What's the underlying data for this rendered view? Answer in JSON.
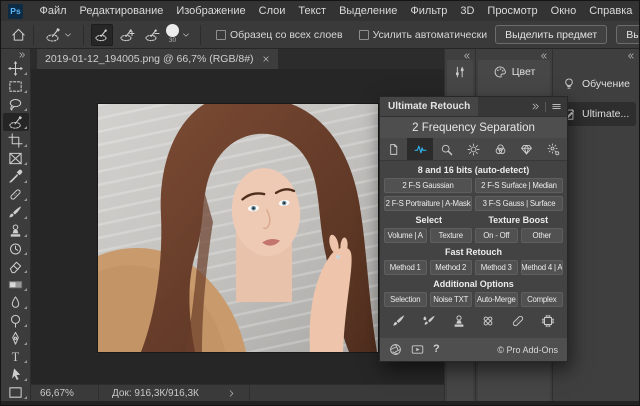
{
  "titlebar": {
    "logo": "Ps",
    "menus": [
      "Файл",
      "Редактирование",
      "Изображение",
      "Слои",
      "Текст",
      "Выделение",
      "Фильтр",
      "3D",
      "Просмотр",
      "Окно",
      "Справка"
    ],
    "window_control_icons": [
      "minimize-icon",
      "maximize-icon",
      "close-icon"
    ]
  },
  "options_bar": {
    "brush_size": "30",
    "sample_all_layers": "Образец со всех слоев",
    "auto_enhance": "Усилить автоматически",
    "select_subject": "Выделить предмет",
    "select_and_mask": "Выделение и маска...",
    "icons": [
      "home-icon",
      "quick-selection-tool-icon",
      "new-selection-icon",
      "add-to-selection-icon",
      "subtract-from-selection-icon",
      "brush-size-circle",
      "search-icon",
      "workspace-switcher-icon",
      "share-icon"
    ]
  },
  "document_tab": {
    "label": "2019-01-12_194005.png @ 66,7% (RGB/8#)"
  },
  "tool_strip": {
    "tools": [
      "move",
      "marquee",
      "lasso",
      "quick-selection",
      "crop",
      "frame",
      "eyedropper",
      "healing-brush",
      "brush",
      "clone-stamp",
      "history-brush",
      "eraser",
      "gradient",
      "blur",
      "dodge",
      "pen",
      "type",
      "path-select",
      "rectangle"
    ],
    "selected": "quick-selection"
  },
  "dock": {
    "color_tab": "Цвет",
    "learn_label": "Обучение",
    "ultimate_label": "Ultimate...",
    "icons": [
      "properties-icon",
      "palette-icon",
      "lightbulb-icon",
      "ultimate-panel-icon",
      "collapse-icon"
    ]
  },
  "panel": {
    "tab": "Ultimate Retouch",
    "title": "2 Frequency Separation",
    "tabs": [
      "document",
      "frequency",
      "zoom",
      "brightness",
      "channels",
      "diamond",
      "settings"
    ],
    "selected_tab": "frequency",
    "bits_label": "8 and 16 bits (auto-detect)",
    "fs_buttons": [
      "2 F-S Gaussian",
      "2 F-S Surface | Median",
      "2 F-S Portraiture | A-Mask",
      "3 F-S Gauss | Surface"
    ],
    "select_label": "Select",
    "texture_boost_label": "Texture Boost",
    "select_buttons": [
      "Volume | A",
      "Texture",
      "On - Off",
      "Other"
    ],
    "fast_retouch_label": "Fast Retouch",
    "fast_buttons": [
      "Method 1",
      "Method 2",
      "Method 3",
      "Method 4 | A"
    ],
    "additional_label": "Additional Options",
    "additional_buttons": [
      "Selection",
      "Noise TXT",
      "Auto-Merge",
      "Complex"
    ],
    "tool_icons": [
      "brush",
      "mixer-brush",
      "stamp",
      "healing",
      "patch",
      "texture-chip"
    ],
    "footer": {
      "help_label": "?",
      "copyright": "© Pro Add-Ons",
      "icons": [
        "shutter-icon",
        "video-icon",
        "help-icon"
      ]
    }
  },
  "status_bar": {
    "zoom": "66,67%",
    "doc": "Док: 916,3К/916,3К"
  },
  "colors": {
    "accent_cyan": "#30b2e8",
    "ps_logo_blue": "#5ab5f5",
    "panel_bg": "#434343",
    "canvas_bg": "#262626"
  }
}
